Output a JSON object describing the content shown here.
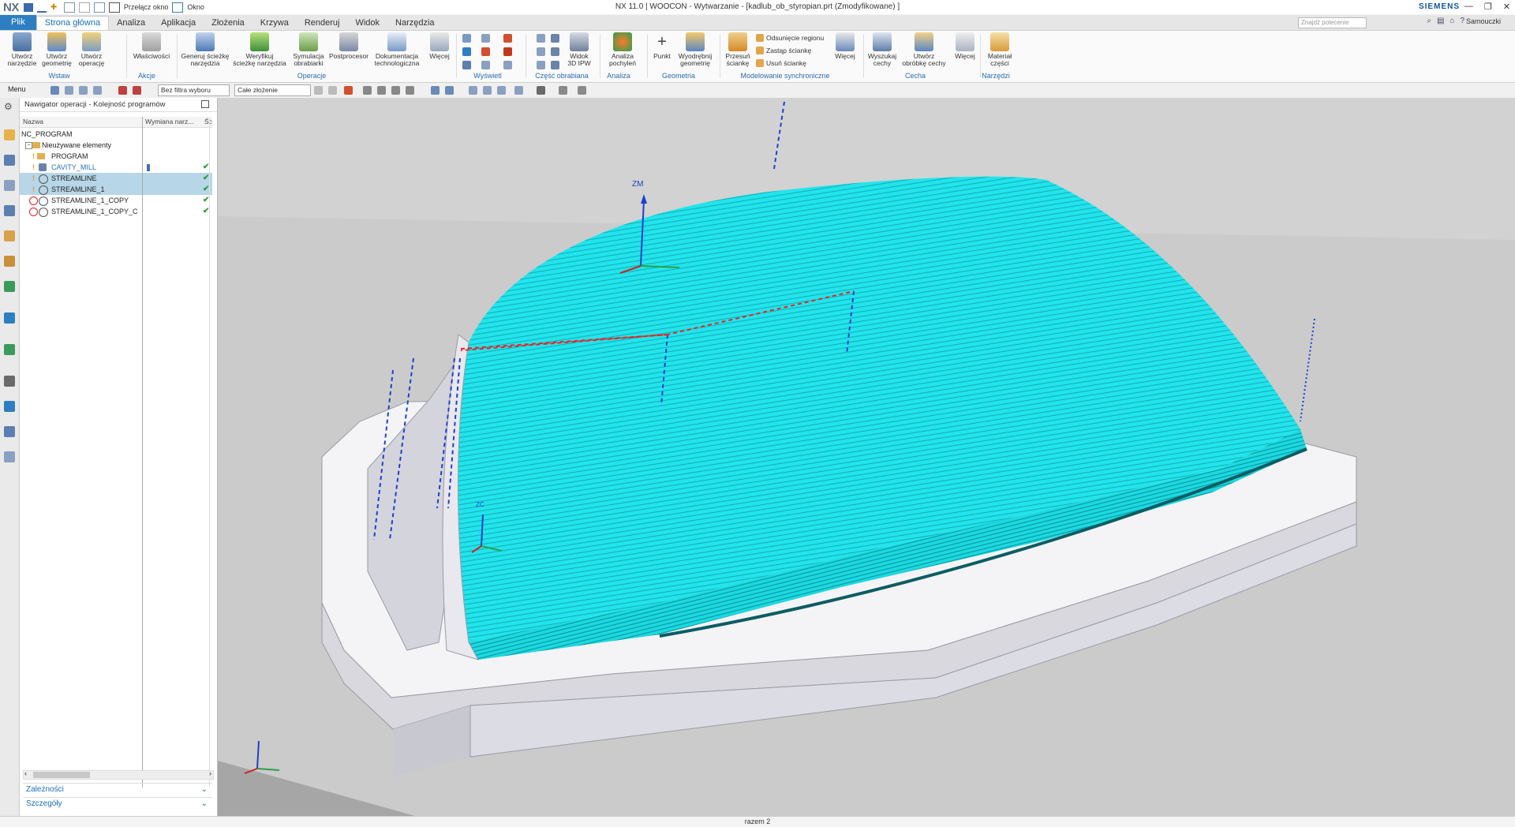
{
  "window": {
    "logo": "NX",
    "title": "NX 11.0 | WOOCON - Wytwarzanie - [kadlub_ob_styropian.prt (Zmodyfikowane) ]",
    "brand": "SIEMENS",
    "quick_access": {
      "switch_window": "Przełącz okno",
      "window": "Okno"
    }
  },
  "menu": {
    "tabs": [
      "Plik",
      "Strona główna",
      "Analiza",
      "Aplikacja",
      "Złożenia",
      "Krzywa",
      "Renderuj",
      "Widok",
      "Narzędzia"
    ],
    "active_tab": "Strona główna",
    "search_placeholder": "Znajdź polecenie",
    "user": "Samouczki"
  },
  "ribbon": {
    "groups": {
      "wstaw": "Wstaw",
      "akcje": "Akcje",
      "operacje": "Operacje",
      "wyswietl": "Wyświetl",
      "czesc_obrabiana": "Część obrabiana",
      "analiza": "Analiza",
      "geometria": "Geometria",
      "modelowanie": "Modelowanie synchroniczne",
      "cecha": "Cecha",
      "narzedzi": "Narzędzi"
    },
    "buttons": {
      "utworz_narzedzie": [
        "Utwórz",
        "narzędzie"
      ],
      "utworz_geometrie": [
        "Utwórz",
        "geometrię"
      ],
      "utworz_operacje": [
        "Utwórz",
        "operację"
      ],
      "wlasciwosci": [
        "Właściwości",
        ""
      ],
      "generuj": [
        "Generuj ścieżkę",
        "narzędzia"
      ],
      "weryfikuj": [
        "Weryfikuj",
        "ścieżkę narzędzia"
      ],
      "symulacja": [
        "Symulacja",
        "obrabiarki"
      ],
      "postprocesor": [
        "Postprocesor",
        ""
      ],
      "dokumentacja": [
        "Dokumentacja",
        "technologiczna"
      ],
      "wiecej1": [
        "Więcej",
        ""
      ],
      "widok3d": [
        "Widok",
        "3D IPW"
      ],
      "analiza_pochylen": [
        "Analiza",
        "pochyleń"
      ],
      "punkt": [
        "Punkt",
        ""
      ],
      "wyodrebnij": [
        "Wyodrębnij",
        "geometrię"
      ],
      "przesun": [
        "Przesuń",
        "ściankę"
      ],
      "wiecej2": [
        "Więcej",
        ""
      ],
      "wyszukaj": [
        "Wyszukaj",
        "cechy"
      ],
      "utworz_obrobke": [
        "Utwórz",
        "obróbkę cechy"
      ],
      "wiecej3": [
        "Więcej",
        ""
      ],
      "material": [
        "Materiał",
        "części"
      ]
    },
    "small_items": {
      "odsuniecie": "Odsunięcie regionu",
      "zastap": "Zastąp ściankę",
      "usun": "Usuń ściankę"
    }
  },
  "toolbar2": {
    "menu": "Menu",
    "filter": "Bez filtra wyboru",
    "scope": "Całe złożenie"
  },
  "navigator": {
    "title": "Nawigator operacji - Kolejność programów",
    "columns": {
      "name": "Nazwa",
      "tool_change": "Wymiana narz...",
      "s": "Śc"
    },
    "rows": [
      {
        "name": "NC_PROGRAM",
        "check": ""
      },
      {
        "name": "Nieużywane elementy",
        "check": ""
      },
      {
        "name": "PROGRAM",
        "check": ""
      },
      {
        "name": "CAVITY_MILL",
        "check": "✔"
      },
      {
        "name": "STREAMLINE",
        "check": "✔"
      },
      {
        "name": "STREAMLINE_1",
        "check": "✔"
      },
      {
        "name": "STREAMLINE_1_COPY",
        "check": "✔"
      },
      {
        "name": "STREAMLINE_1_COPY_C",
        "check": "✔"
      }
    ],
    "dependencies": "Zależności",
    "details": "Szczegóły"
  },
  "viewport": {
    "zm_label": "ZM",
    "zc_label": "ZC"
  },
  "status": {
    "text": "razem 2"
  },
  "colors": {
    "accent": "#2d7fc1",
    "toolpath": "#21e3ea",
    "toolpath_dark": "#0aa7ad",
    "selection": "#b7d6e7",
    "part": "#ededf2"
  }
}
